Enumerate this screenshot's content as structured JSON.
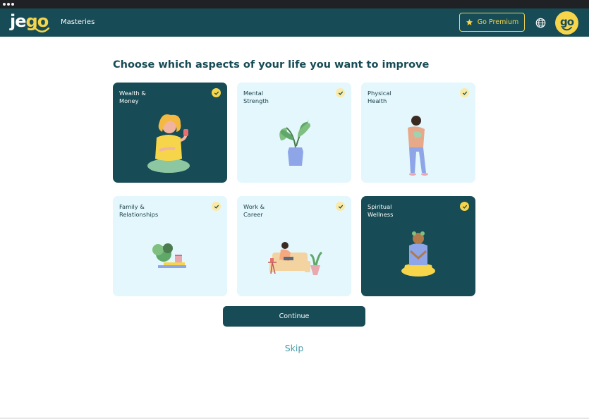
{
  "header": {
    "logo_text_first": "je",
    "logo_text_second": "go",
    "nav_masteries": "Masteries",
    "premium_label": "Go Premium",
    "avatar_text": "go"
  },
  "colors": {
    "brand_dark": "#174b55",
    "brand_yellow": "#f6d54a",
    "card_light": "#e3f7fd",
    "link": "#4a9ba8"
  },
  "main": {
    "title": "Choose which aspects of your life you want to improve",
    "cards": [
      {
        "label": "Wealth &\nMoney",
        "selected": true,
        "icon": "meditating-woman-with-drink"
      },
      {
        "label": "Mental\nStrength",
        "selected": false,
        "icon": "potted-plant"
      },
      {
        "label": "Physical\nHealth",
        "selected": false,
        "icon": "standing-person"
      },
      {
        "label": "Family &\nRelationships",
        "selected": false,
        "icon": "plant-with-books"
      },
      {
        "label": "Work &\nCareer",
        "selected": false,
        "icon": "person-on-sofa-with-laptop"
      },
      {
        "label": "Spiritual\nWellness",
        "selected": true,
        "icon": "meditating-person"
      }
    ],
    "continue_label": "Continue",
    "skip_label": "Skip"
  }
}
